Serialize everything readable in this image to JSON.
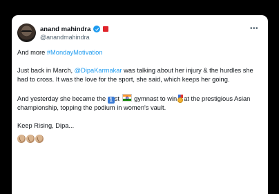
{
  "author": {
    "name": "anand mahindra",
    "handle": "@anandmahindra"
  },
  "menu_glyph": "•••",
  "tweet": {
    "line1_prefix": "And more ",
    "line1_tag": "#MondayMotivation",
    "para2_a": "Just back in March, ",
    "para2_mention": "@DipaKarmakar",
    "para2_b": " was talking about her injury & the hurdles she had to cross. It was the love for the sport, she said, which keeps her going.",
    "para3_a": "And yesterday she became the ",
    "para3_keycap": "1",
    "para3_b": "st ",
    "para3_c": " gymnast to win",
    "para3_d": "at the prestigious Asian championship, topping the podium in women's vault.",
    "para4": "Keep Rising, Dipa...",
    "clap_count": 3
  },
  "colors": {
    "link": "#1d9bf0",
    "verified": "#1d9bf0",
    "affiliation": "#e0242b"
  }
}
